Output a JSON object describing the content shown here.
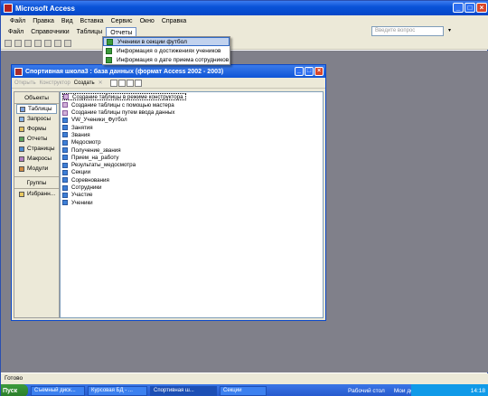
{
  "app": {
    "title": "Microsoft Access"
  },
  "menu1": [
    "Файл",
    "Правка",
    "Вид",
    "Вставка",
    "Сервис",
    "Окно",
    "Справка"
  ],
  "menu2": {
    "items": [
      "Файл",
      "Справочники",
      "Таблицы",
      "Отчеты"
    ],
    "active": "Отчеты",
    "ask_placeholder": "Введите вопрос"
  },
  "dropdown": [
    {
      "label": "Ученики в секции футбол",
      "selected": true
    },
    {
      "label": "Информация о достижениях учеников",
      "selected": false
    },
    {
      "label": "Информация о дате приема сотрудников",
      "selected": false
    }
  ],
  "dbwin": {
    "title": "Спортивная школа3 : база данных (формат Access 2002 - 2003)",
    "tools": {
      "open": "Открыть",
      "design": "Конструктор",
      "create": "Создать"
    }
  },
  "sidebar": {
    "objects_title": "Объекты",
    "items": [
      "Таблицы",
      "Запросы",
      "Формы",
      "Отчеты",
      "Страницы",
      "Макросы",
      "Модули"
    ],
    "groups_title": "Группы",
    "groups": [
      "Избранн..."
    ]
  },
  "list": [
    {
      "label": "Создание таблицы в режиме конструктора",
      "cmd": true
    },
    {
      "label": "Создание таблицы с помощью мастера",
      "cmd": true
    },
    {
      "label": "Создание таблицы путем ввода данных",
      "cmd": true
    },
    {
      "label": "VW_Ученики_Футбол",
      "cmd": false
    },
    {
      "label": "Занятия",
      "cmd": false
    },
    {
      "label": "Звания",
      "cmd": false
    },
    {
      "label": "Медосмотр",
      "cmd": false
    },
    {
      "label": "Получение_звания",
      "cmd": false
    },
    {
      "label": "Прием_на_работу",
      "cmd": false
    },
    {
      "label": "Результаты_медосмотра",
      "cmd": false
    },
    {
      "label": "Секции",
      "cmd": false
    },
    {
      "label": "Соревнования",
      "cmd": false
    },
    {
      "label": "Сотрудники",
      "cmd": false
    },
    {
      "label": "Участие",
      "cmd": false
    },
    {
      "label": "Ученики",
      "cmd": false
    }
  ],
  "status": "Готово",
  "taskbar": {
    "start": "Пуск",
    "tasks": [
      {
        "label": "Съемный диск...",
        "active": false
      },
      {
        "label": "Курсовая БД - ...",
        "active": false
      },
      {
        "label": "Спортивная ш...",
        "active": true
      },
      {
        "label": "Секции",
        "active": false
      }
    ],
    "desktop": "Рабочий стол",
    "mycomp": "Мои до",
    "time": "14:18"
  },
  "colors": {
    "titlebar": "#0a53d8",
    "workspace": "#80808a",
    "taskbar": "#2558cc"
  }
}
